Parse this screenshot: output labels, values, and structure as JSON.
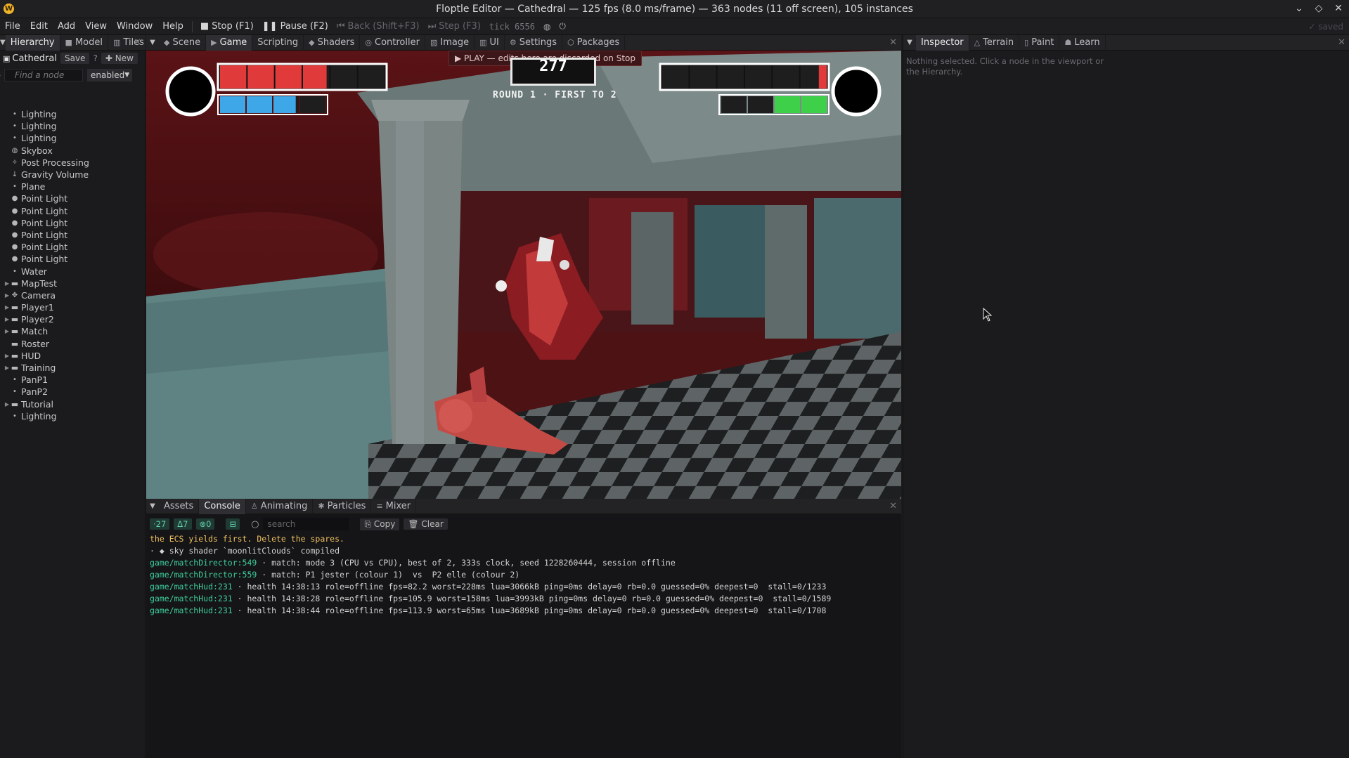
{
  "window": {
    "app_icon": "W",
    "title": "Floptle Editor — Cathedral — 125 fps (8.0 ms/frame) — 363 nodes (11 off screen), 105 instances",
    "controls": [
      "⌄",
      "◇",
      "✕"
    ]
  },
  "menubar": {
    "menus": [
      "File",
      "Edit",
      "Add",
      "View",
      "Window",
      "Help"
    ],
    "stop": "Stop  (F1)",
    "pause": "Pause  (F2)",
    "back": "Back  (Shift+F3)",
    "step": "Step  (F3)",
    "tick": "tick 6556",
    "saved": "✓ saved"
  },
  "left_panel": {
    "tabs": [
      "Hierarchy",
      "Model",
      "Tiles"
    ],
    "scene_name": "Cathedral",
    "save_label": "Save",
    "help_label": "?",
    "new_label": "New",
    "find_placeholder": "Find a node",
    "filter_value": "enabled",
    "nodes": [
      {
        "label": "Lighting",
        "icon": "dot",
        "expandable": false
      },
      {
        "label": "Lighting",
        "icon": "dot",
        "expandable": false
      },
      {
        "label": "Lighting",
        "icon": "dot",
        "expandable": false
      },
      {
        "label": "Skybox",
        "icon": "globe",
        "expandable": false
      },
      {
        "label": "Post Processing",
        "icon": "sparkle",
        "expandable": false
      },
      {
        "label": "Gravity Volume",
        "icon": "down-arrow",
        "expandable": false
      },
      {
        "label": "Plane",
        "icon": "dot",
        "expandable": false
      },
      {
        "label": "Point Light",
        "icon": "bulb",
        "expandable": false
      },
      {
        "label": "Point Light",
        "icon": "bulb",
        "expandable": false
      },
      {
        "label": "Point Light",
        "icon": "bulb",
        "expandable": false
      },
      {
        "label": "Point Light",
        "icon": "bulb",
        "expandable": false
      },
      {
        "label": "Point Light",
        "icon": "bulb",
        "expandable": false
      },
      {
        "label": "Point Light",
        "icon": "bulb",
        "expandable": false
      },
      {
        "label": "Water",
        "icon": "dot",
        "expandable": false
      },
      {
        "label": "MapTest",
        "icon": "folder",
        "expandable": true
      },
      {
        "label": "Camera",
        "icon": "camera",
        "expandable": true
      },
      {
        "label": "Player1",
        "icon": "folder",
        "expandable": true
      },
      {
        "label": "Player2",
        "icon": "folder",
        "expandable": true
      },
      {
        "label": "Match",
        "icon": "folder",
        "expandable": true
      },
      {
        "label": "Roster",
        "icon": "folder",
        "expandable": false
      },
      {
        "label": "HUD",
        "icon": "folder",
        "expandable": true
      },
      {
        "label": "Training",
        "icon": "folder",
        "expandable": true
      },
      {
        "label": "PanP1",
        "icon": "dot",
        "expandable": false
      },
      {
        "label": "PanP2",
        "icon": "dot",
        "expandable": false
      },
      {
        "label": "Tutorial",
        "icon": "folder",
        "expandable": true
      },
      {
        "label": "Lighting",
        "icon": "dot",
        "expandable": false
      }
    ]
  },
  "viewport": {
    "tabs": [
      "Scene",
      "Game",
      "Scripting",
      "Shaders",
      "Controller",
      "Image",
      "UI",
      "Settings",
      "Packages"
    ],
    "active_tab": "Game",
    "banner": "▶ PLAY — edits here are discarded on Stop",
    "timer": "277",
    "round_text": "ROUND 1  ·  FIRST TO 2",
    "p1_health_fraction": 0.65,
    "p2_health_fraction": 0.05,
    "p1_meter_fraction": 0.72,
    "p2_meter_fraction": 0.5
  },
  "right_panel": {
    "tabs": [
      "Inspector",
      "Terrain",
      "Paint",
      "Learn"
    ],
    "empty_message": "Nothing selected. Click a node in the viewport or the Hierarchy."
  },
  "bottom_panel": {
    "tabs": [
      "Assets",
      "Console",
      "Animating",
      "Particles",
      "Mixer"
    ],
    "active_tab": "Console",
    "count_info": "27",
    "count_warn": "7",
    "count_error": "0",
    "search_placeholder": "search",
    "copy_label": "Copy",
    "clear_label": "Clear",
    "log": [
      {
        "source": "",
        "text": "the ECS yields first. Delete the spares.",
        "level": "warn"
      },
      {
        "source": "",
        "text": "· ◆ sky shader `moonlitClouds` compiled",
        "level": "info"
      },
      {
        "source": "game/matchDirector:549",
        "text": " · match: mode 3 (CPU vs CPU), best of 2, 333s clock, seed 1228260444, session offline",
        "level": "info"
      },
      {
        "source": "game/matchDirector:559",
        "text": " · match: P1 jester (colour 1)  vs  P2 elle (colour 2)",
        "level": "info"
      },
      {
        "source": "game/matchHud:231",
        "text": " · health 14:38:13 role=offline fps=82.2 worst=228ms lua=3066kB ping=0ms delay=0 rb=0.0 guessed=0% deepest=0  stall=0/1233",
        "level": "info"
      },
      {
        "source": "game/matchHud:231",
        "text": " · health 14:38:28 role=offline fps=105.9 worst=158ms lua=3993kB ping=0ms delay=0 rb=0.0 guessed=0% deepest=0  stall=0/1589",
        "level": "info"
      },
      {
        "source": "game/matchHud:231",
        "text": " · health 14:38:44 role=offline fps=113.9 worst=65ms lua=3689kB ping=0ms delay=0 rb=0.0 guessed=0% deepest=0  stall=0/1708",
        "level": "info"
      }
    ]
  },
  "colors": {
    "accent_green": "#3ecf9b",
    "warn_yellow": "#f0c060",
    "p1_health": "#e03a3a",
    "p1_meter": "#3ea7e8",
    "p2_meter": "#3fd04a"
  }
}
